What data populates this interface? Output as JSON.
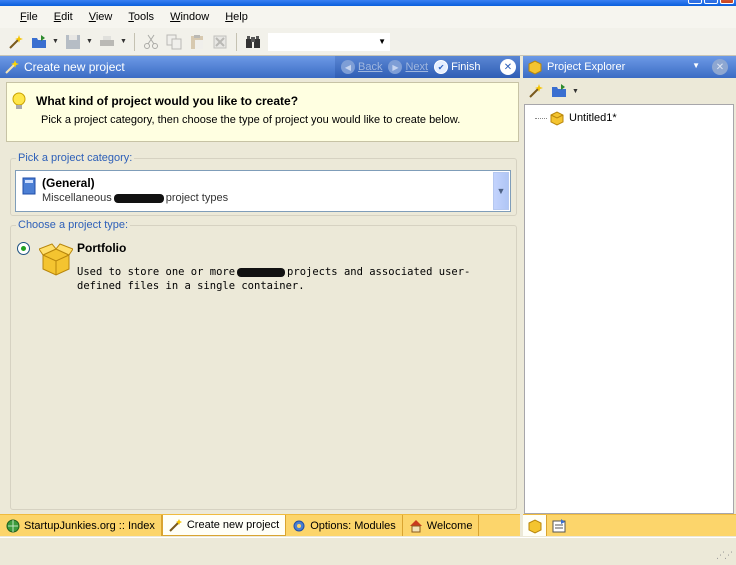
{
  "menu": [
    "File",
    "Edit",
    "View",
    "Tools",
    "Window",
    "Help"
  ],
  "wizard": {
    "title": "Create new project",
    "back_label": "Back",
    "next_label": "Next",
    "finish_label": "Finish",
    "question": "What kind of project would you like to create?",
    "hint": "Pick a project category, then choose the type of project you would like to create below.",
    "category_group_label": "Pick a project category:",
    "category_name": "(General)",
    "category_desc_before": "Miscellaneous",
    "category_desc_after": "project types",
    "type_group_label": "Choose a project type:",
    "type_name": "Portfolio",
    "type_desc_before": "Used to store one or more",
    "type_desc_after": "projects and associated user-defined files in a single container."
  },
  "explorer": {
    "title": "Project Explorer",
    "tree_item": "Untitled1*"
  },
  "tabs": [
    {
      "label": "StartupJunkies.org :: Index"
    },
    {
      "label": "Create new project"
    },
    {
      "label": "Options: Modules"
    },
    {
      "label": "Welcome"
    }
  ],
  "colors": {
    "header_blue": "#3b6cc4",
    "tab_orange": "#fcd56b",
    "info_yellow": "#ffffe1",
    "group_label_blue": "#2d5fb8"
  }
}
